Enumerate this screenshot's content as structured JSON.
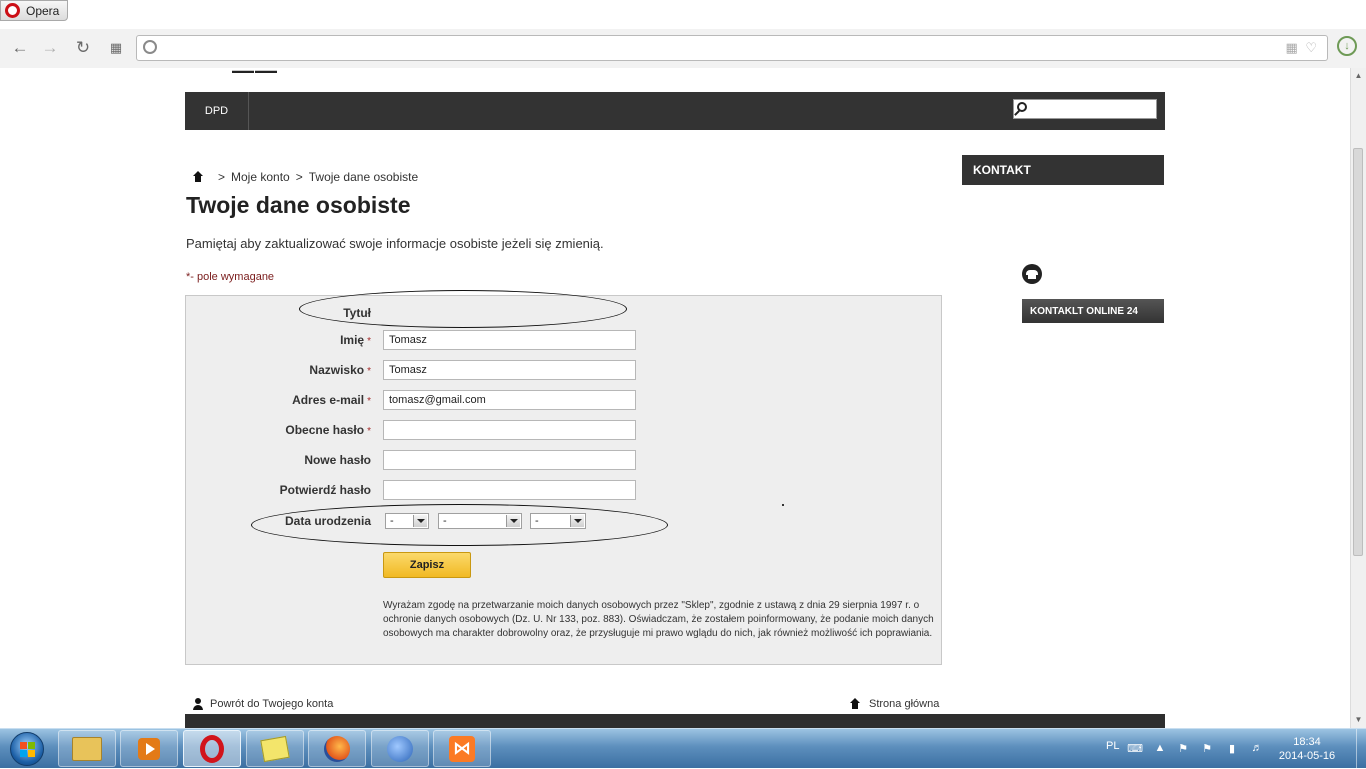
{
  "browser": {
    "menu_label": "Opera",
    "address_url": ""
  },
  "site": {
    "logo_partial": "——",
    "nav": {
      "dpd": "DPD"
    },
    "search": {
      "placeholder": ""
    }
  },
  "breadcrumb": {
    "separator": ">",
    "items": [
      "Moje konto",
      "Twoje dane osobiste"
    ]
  },
  "page": {
    "title": "Twoje dane osobiste",
    "intro": "Pamiętaj aby zaktualizować swoje informacje osobiste jeżeli się zmienią.",
    "required_note": "*- pole wymagane"
  },
  "form": {
    "title_label": "Tytuł",
    "first_name": {
      "label": "Imię",
      "value": "Tomasz"
    },
    "last_name": {
      "label": "Nazwisko",
      "value": "Tomasz"
    },
    "email": {
      "label": "Adres e-mail",
      "value": "tomasz@gmail.com"
    },
    "current_password": {
      "label": "Obecne hasło",
      "value": ""
    },
    "new_password": {
      "label": "Nowe hasło",
      "value": ""
    },
    "confirm_password": {
      "label": "Potwierdź hasło",
      "value": ""
    },
    "birthdate": {
      "label": "Data urodzenia",
      "day": "-",
      "month": "-",
      "year": "-"
    },
    "required_marker": "*",
    "save_label": "Zapisz",
    "consent": "Wyrażam zgodę na przetwarzanie moich danych osobowych przez \"Sklep\", zgodnie z ustawą z dnia 29 sierpnia 1997 r. o ochronie danych osobowych (Dz. U. Nr 133, poz. 883). Oświadczam, że zostałem poinformowany, że podanie moich danych osobowych ma charakter dobrowolny oraz, że przysługuje mi prawo wglądu do nich, jak również możliwość ich poprawiania."
  },
  "footer_links": {
    "back": "Powrót do Twojego konta",
    "home": "Strona główna"
  },
  "sidebar": {
    "kontakt_title": "KONTAKT",
    "online_button": "KONTAKLT ONLINE 24"
  },
  "taskbar": {
    "apps": [
      "explorer",
      "media-player",
      "opera",
      "sticky-notes",
      "firefox",
      "thunderbird",
      "xampp"
    ],
    "active_app": "opera",
    "language": "PL",
    "time": "18:34",
    "date": "2014-05-16"
  },
  "colors": {
    "nav_bar": "#333333",
    "save_button": "#f1b923",
    "required_star": "#a52a2a",
    "form_panel": "#eeeeee"
  }
}
